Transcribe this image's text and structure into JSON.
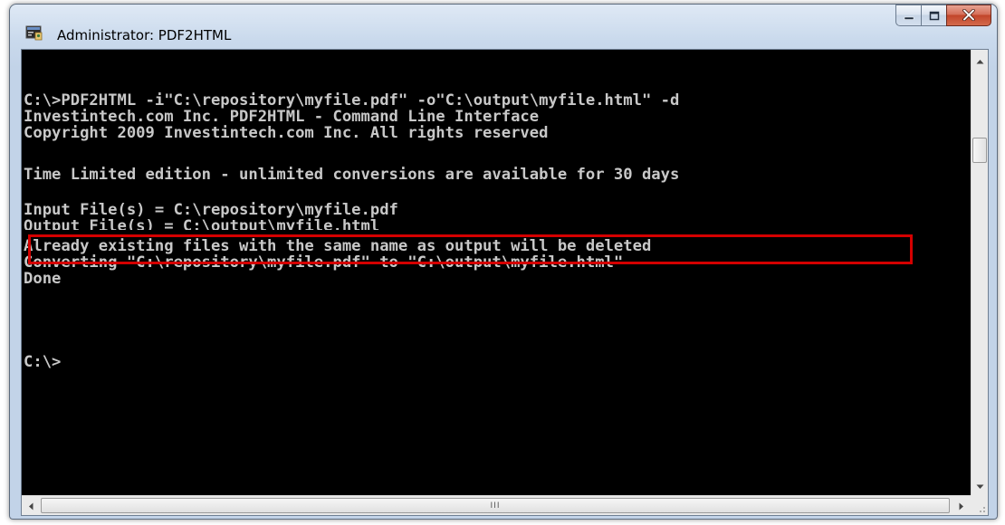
{
  "window": {
    "title": "Administrator: PDF2HTML",
    "icon": "console-app-icon"
  },
  "caption_buttons": {
    "minimize": "minimize-icon",
    "maximize": "maximize-icon",
    "close": "close-icon"
  },
  "console": {
    "lines": [
      "C:\\>PDF2HTML -i\"C:\\repository\\myfile.pdf\" -o\"C:\\output\\myfile.html\" -d",
      "Investintech.com Inc. PDF2HTML - Command Line Interface",
      "Copyright 2009 Investintech.com Inc. All rights reserved",
      "",
      "Time Limited edition - unlimited conversions are available for 30 days",
      "",
      "Input File(s) = C:\\repository\\myfile.pdf",
      "Output File(s) = C:\\output\\myfile.html",
      "Already existing files with the same name as output will be deleted",
      "Converting \"C:\\repository\\myfile.pdf\" to \"C:\\output\\myfile.html\"",
      "Done",
      "",
      "",
      "",
      "C:\\>"
    ],
    "highlighted_line": "Already existing files with the same name as output will be deleted",
    "highlight_color": "#d40000",
    "background": "#000000",
    "text_color": "#c8c8c8"
  },
  "scrollbars": {
    "horizontal_grip": "III"
  }
}
